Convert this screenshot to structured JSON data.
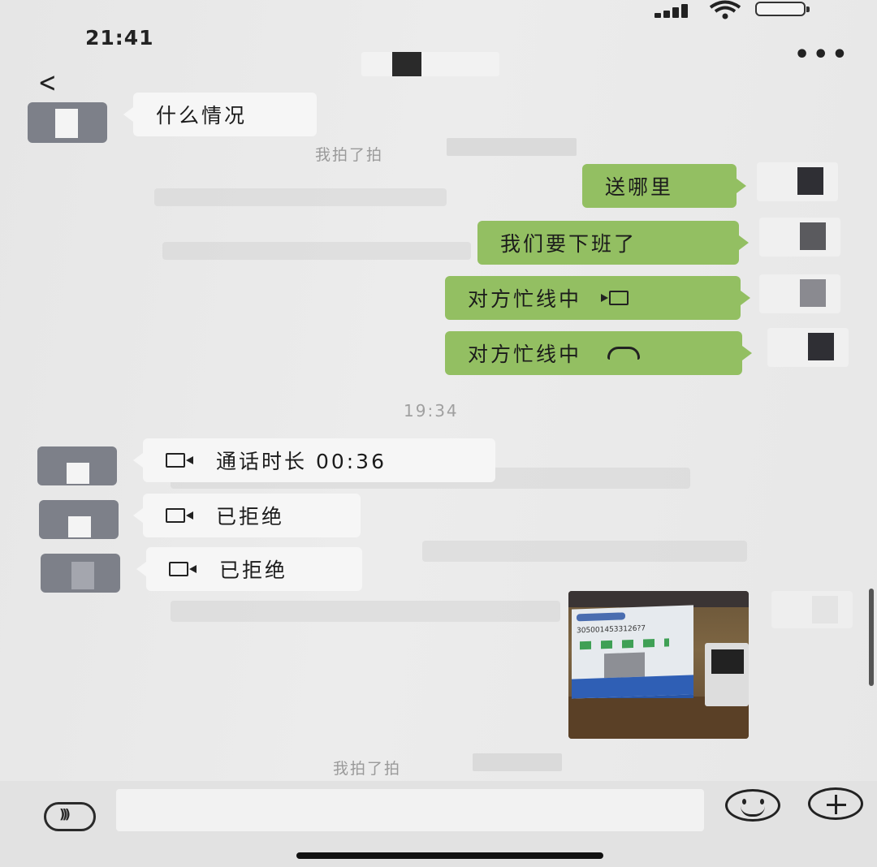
{
  "status": {
    "time": "21:41"
  },
  "header": {
    "back_icon": "chevron-left-icon",
    "more_icon": "ellipsis-icon"
  },
  "messages": [
    {
      "side": "left",
      "text": "什么情况"
    },
    {
      "side": "system",
      "text": "我拍了拍"
    },
    {
      "side": "right",
      "text": "送哪里"
    },
    {
      "side": "right",
      "text": "我们要下班了"
    },
    {
      "side": "right",
      "text": "对方忙线中",
      "icon": "video-call-icon"
    },
    {
      "side": "right",
      "text": "对方忙线中",
      "icon": "phone-call-icon"
    },
    {
      "side": "timestamp",
      "text": "19:34"
    },
    {
      "side": "left",
      "text": "通话时长 00:36",
      "icon": "video-call-icon"
    },
    {
      "side": "left",
      "text": "已拒绝",
      "icon": "video-call-icon"
    },
    {
      "side": "left",
      "text": "已拒绝",
      "icon": "video-call-icon"
    },
    {
      "side": "right",
      "type": "image",
      "photo_text": "3050014533126?7"
    },
    {
      "side": "system",
      "text": "我拍了拍"
    }
  ],
  "colors": {
    "sent_bubble": "#93bf62",
    "received_bubble": "#f6f6f6",
    "background": "#e8e8e8"
  }
}
